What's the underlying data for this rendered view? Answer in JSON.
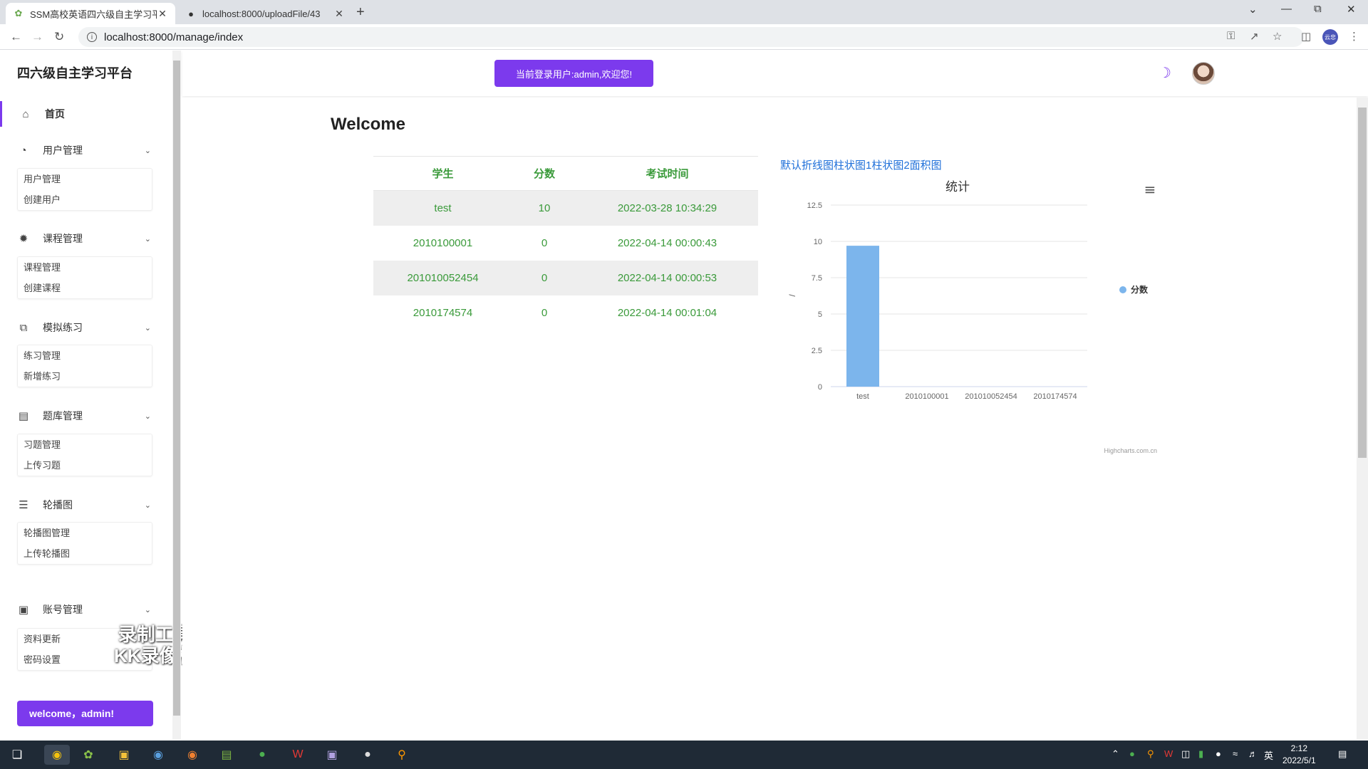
{
  "browser": {
    "tabs": [
      {
        "title": "SSM高校英语四六级自主学习平台",
        "active": true,
        "favicon": "leaf-icon"
      },
      {
        "title": "localhost:8000/uploadFile/43",
        "active": false,
        "favicon": "globe-icon"
      }
    ],
    "url": "localhost:8000/manage/index",
    "profile_label": "云忠"
  },
  "sidebar": {
    "brand": "四六级自主学习平台",
    "home": "首页",
    "groups": [
      {
        "label": "用户管理",
        "icon": "pie-chart-icon",
        "items": [
          "用户管理",
          "创建用户"
        ]
      },
      {
        "label": "课程管理",
        "icon": "magic-wand-icon",
        "items": [
          "课程管理",
          "创建课程"
        ]
      },
      {
        "label": "模拟练习",
        "icon": "copy-icon",
        "items": [
          "练习管理",
          "新增练习"
        ]
      },
      {
        "label": "题库管理",
        "icon": "clipboard-icon",
        "items": [
          "习题管理",
          "上传习题"
        ]
      },
      {
        "label": "轮播图",
        "icon": "list-icon",
        "items": [
          "轮播图管理",
          "上传轮播图"
        ]
      },
      {
        "label": "账号管理",
        "icon": "layout-icon",
        "items": [
          "资料更新",
          "密码设置"
        ]
      }
    ],
    "welcome_button": "welcome，admin!"
  },
  "watermark": {
    "line1": "录制工具",
    "line2": "KK录像机"
  },
  "header": {
    "login_notice": "当前登录用户:admin,欢迎您!"
  },
  "main": {
    "title": "Welcome",
    "table": {
      "headers": [
        "学生",
        "分数",
        "考试时间"
      ],
      "rows": [
        [
          "test",
          "10",
          "2022-03-28 10:34:29"
        ],
        [
          "2010100001",
          "0",
          "2022-04-14 00:00:43"
        ],
        [
          "201010052454",
          "0",
          "2022-04-14 00:00:53"
        ],
        [
          "2010174574",
          "0",
          "2022-04-14 00:01:04"
        ]
      ]
    },
    "chart_links": "默认折线图柱状图1柱状图2面积图"
  },
  "chart_data": {
    "type": "bar",
    "title": "统计",
    "categories": [
      "test",
      "2010100001",
      "201010052454",
      "2010174574"
    ],
    "series": [
      {
        "name": "分数",
        "values": [
          9.7,
          0,
          0,
          0
        ],
        "color": "#7cb5ec"
      }
    ],
    "ylim": [
      0,
      12.5
    ],
    "yticks": [
      "0",
      "2.5",
      "5",
      "7.5",
      "10",
      "12.5"
    ],
    "ylabel": "/",
    "legend_position": "right",
    "credits": "Highcharts.com.cn",
    "grid": true
  },
  "taskbar": {
    "time": "2:12",
    "date": "2022/5/1",
    "ime": "英"
  },
  "colors": {
    "accent": "#7c3aed",
    "table_text": "#3a9a3a",
    "link": "#1e6fd9"
  }
}
